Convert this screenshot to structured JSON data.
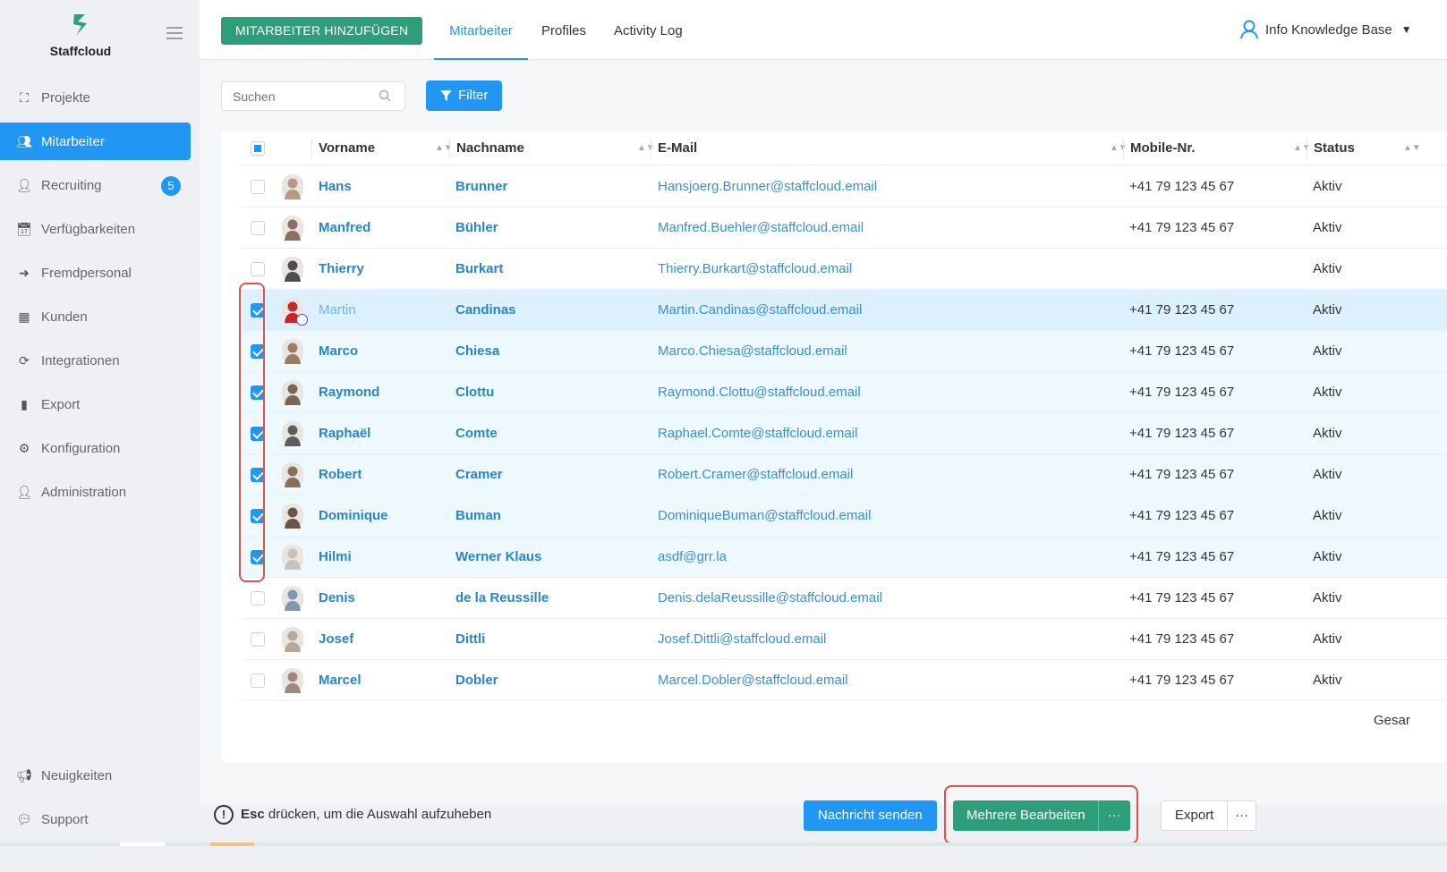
{
  "app": {
    "name": "Staffcloud",
    "brand_color": "#2e9e7a",
    "accent_color": "#2196f3"
  },
  "sidebar": {
    "items": [
      {
        "label": "Projekte",
        "icon": "sitemap-icon"
      },
      {
        "label": "Mitarbeiter",
        "icon": "users-icon",
        "active": true
      },
      {
        "label": "Recruiting",
        "icon": "user-plus-icon",
        "badge": "5"
      },
      {
        "label": "Verfügbarkeiten",
        "icon": "calendar-check-icon"
      },
      {
        "label": "Fremdpersonal",
        "icon": "sign-in-icon"
      },
      {
        "label": "Kunden",
        "icon": "building-icon"
      },
      {
        "label": "Integrationen",
        "icon": "sync-icon"
      },
      {
        "label": "Export",
        "icon": "file-icon"
      },
      {
        "label": "Konfiguration",
        "icon": "gear-icon"
      },
      {
        "label": "Administration",
        "icon": "user-cog-icon"
      }
    ],
    "bottom": [
      {
        "label": "Neuigkeiten",
        "icon": "megaphone-icon"
      },
      {
        "label": "Support",
        "icon": "comments-icon"
      }
    ]
  },
  "topbar": {
    "add_label": "MITARBEITER HINZUFÜGEN",
    "tabs": [
      {
        "label": "Mitarbeiter",
        "active": true
      },
      {
        "label": "Profiles"
      },
      {
        "label": "Activity Log"
      }
    ],
    "user_label": "Info Knowledge Base"
  },
  "toolbar": {
    "search_placeholder": "Suchen",
    "filter_label": "Filter"
  },
  "table": {
    "columns": [
      "Vorname",
      "Nachname",
      "E-Mail",
      "Mobile-Nr.",
      "Status"
    ],
    "rows": [
      {
        "first": "Hans",
        "last": "Brunner",
        "email": "Hansjoerg.Brunner@staffcloud.email",
        "mobile": "+41 79 123 45 67",
        "status": "Aktiv",
        "checked": false
      },
      {
        "first": "Manfred",
        "last": "Bühler",
        "email": "Manfred.Buehler@staffcloud.email",
        "mobile": "+41 79 123 45 67",
        "status": "Aktiv",
        "checked": false
      },
      {
        "first": "Thierry",
        "last": "Burkart",
        "email": "Thierry.Burkart@staffcloud.email",
        "mobile": "",
        "status": "Aktiv",
        "checked": false
      },
      {
        "first": "Martin",
        "last": "Candinas",
        "email": "Martin.Candinas@staffcloud.email",
        "mobile": "+41 79 123 45 67",
        "status": "Aktiv",
        "checked": true,
        "highlight": true
      },
      {
        "first": "Marco",
        "last": "Chiesa",
        "email": "Marco.Chiesa@staffcloud.email",
        "mobile": "+41 79 123 45 67",
        "status": "Aktiv",
        "checked": true
      },
      {
        "first": "Raymond",
        "last": "Clottu",
        "email": "Raymond.Clottu@staffcloud.email",
        "mobile": "+41 79 123 45 67",
        "status": "Aktiv",
        "checked": true
      },
      {
        "first": "Raphaël",
        "last": "Comte",
        "email": "Raphael.Comte@staffcloud.email",
        "mobile": "+41 79 123 45 67",
        "status": "Aktiv",
        "checked": true
      },
      {
        "first": "Robert",
        "last": "Cramer",
        "email": "Robert.Cramer@staffcloud.email",
        "mobile": "+41 79 123 45 67",
        "status": "Aktiv",
        "checked": true
      },
      {
        "first": "Dominique",
        "last": "Buman",
        "email": "DominiqueBuman@staffcloud.email",
        "mobile": "+41 79 123 45 67",
        "status": "Aktiv",
        "checked": true
      },
      {
        "first": "Hilmi",
        "last": "Werner Klaus",
        "email": "asdf@grr.la",
        "mobile": "+41 79 123 45 67",
        "status": "Aktiv",
        "checked": true
      },
      {
        "first": "Denis",
        "last": "de la Reussille",
        "email": "Denis.delaReussille@staffcloud.email",
        "mobile": "+41 79 123 45 67",
        "status": "Aktiv",
        "checked": false
      },
      {
        "first": "Josef",
        "last": "Dittli",
        "email": "Josef.Dittli@staffcloud.email",
        "mobile": "+41 79 123 45 67",
        "status": "Aktiv",
        "checked": false
      },
      {
        "first": "Marcel",
        "last": "Dobler",
        "email": "Marcel.Dobler@staffcloud.email",
        "mobile": "+41 79 123 45 67",
        "status": "Aktiv",
        "checked": false
      }
    ],
    "total_label": "Gesar"
  },
  "footer": {
    "esc_key": "Esc",
    "esc_text": "drücken, um die Auswahl aufzuheben",
    "message_label": "Nachricht senden",
    "multi_edit_label": "Mehrere Bearbeiten",
    "more_label": "···",
    "export_label": "Export"
  }
}
